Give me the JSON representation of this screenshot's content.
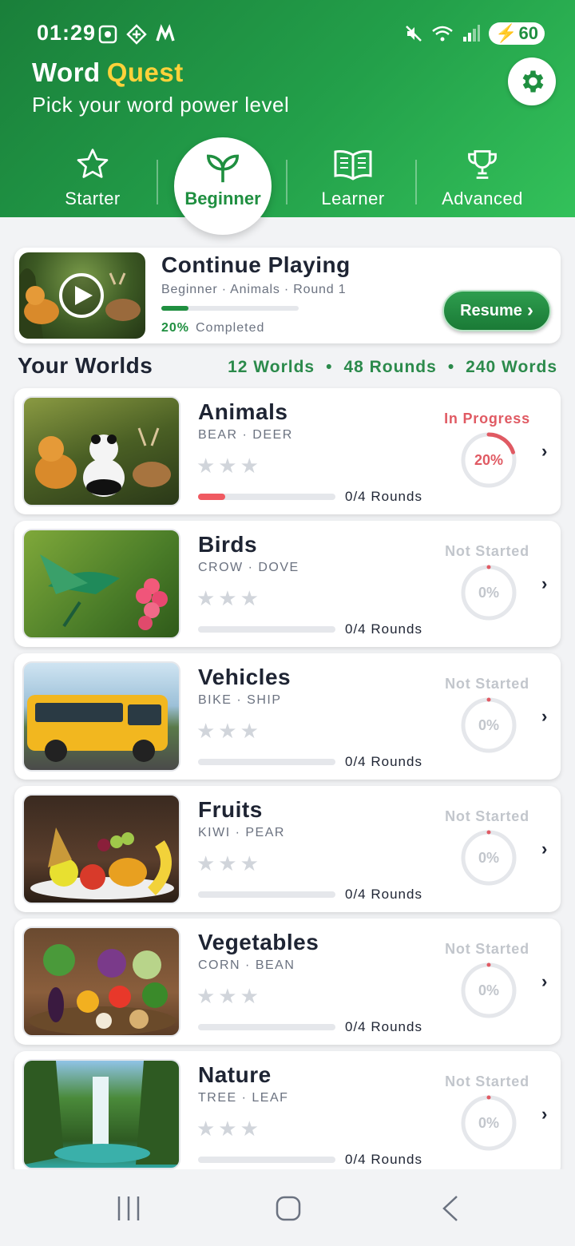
{
  "status_bar": {
    "time": "01:29",
    "battery": "60"
  },
  "app": {
    "brand_word": "Word",
    "brand_quest": "Quest",
    "subtitle": "Pick your word power level"
  },
  "tabs": [
    {
      "label": "Starter",
      "icon": "star-icon"
    },
    {
      "label": "Beginner",
      "icon": "sprout-icon",
      "active": true
    },
    {
      "label": "Learner",
      "icon": "book-icon"
    },
    {
      "label": "Advanced",
      "icon": "trophy-icon"
    }
  ],
  "continue": {
    "title": "Continue Playing",
    "meta": "Beginner · Animals · Round 1",
    "progress": 0.2,
    "pct": "20%",
    "completed": "Completed",
    "resume": "Resume"
  },
  "worlds_header": {
    "title": "Your Worlds",
    "worlds": "12 Worlds",
    "rounds": "48 Rounds",
    "words": "240 Words",
    "dot": "•"
  },
  "worlds": [
    {
      "name": "Animals",
      "words": "BEAR · DEER",
      "stars": "★★★",
      "rounds": "0/4 Rounds",
      "status": "In Progress",
      "pct": "20%",
      "progress": 0.2,
      "chev": "›"
    },
    {
      "name": "Birds",
      "words": "CROW · DOVE",
      "stars": "★★★",
      "rounds": "0/4 Rounds",
      "status": "Not Started",
      "pct": "0%",
      "progress": 0,
      "chev": "›"
    },
    {
      "name": "Vehicles",
      "words": "BIKE · SHIP",
      "stars": "★★★",
      "rounds": "0/4 Rounds",
      "status": "Not Started",
      "pct": "0%",
      "progress": 0,
      "chev": "›"
    },
    {
      "name": "Fruits",
      "words": "KIWI · PEAR",
      "stars": "★★★",
      "rounds": "0/4 Rounds",
      "status": "Not Started",
      "pct": "0%",
      "progress": 0,
      "chev": "›"
    },
    {
      "name": "Vegetables",
      "words": "CORN · BEAN",
      "stars": "★★★",
      "rounds": "0/4 Rounds",
      "status": "Not Started",
      "pct": "0%",
      "progress": 0,
      "chev": "›"
    },
    {
      "name": "Nature",
      "words": "TREE · LEAF",
      "stars": "★★★",
      "rounds": "0/4 Rounds",
      "status": "Not Started",
      "pct": "0%",
      "progress": 0,
      "chev": "›"
    }
  ],
  "colors": {
    "brand_green": "#1f8f40",
    "accent_red": "#e05a63",
    "gold": "#ffd23a"
  }
}
